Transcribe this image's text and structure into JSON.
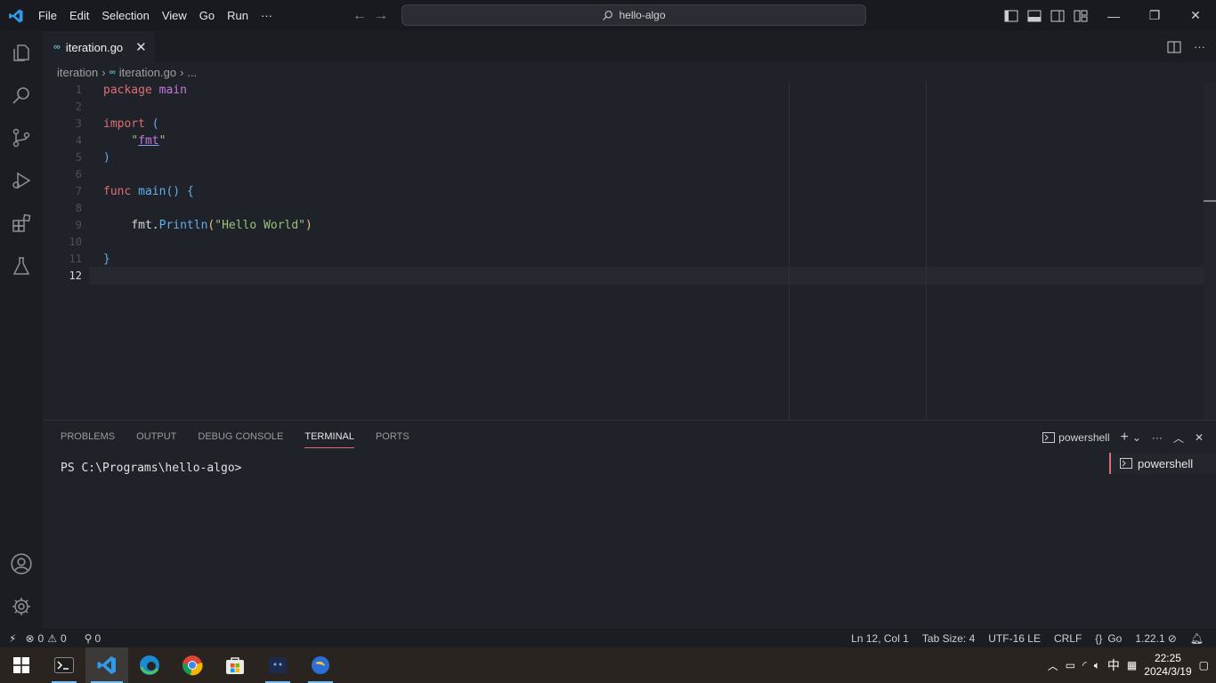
{
  "titlebar": {
    "menu": [
      "File",
      "Edit",
      "Selection",
      "View",
      "Go",
      "Run",
      "···"
    ],
    "command_center": "hello-algo",
    "window_controls": [
      "minimize",
      "restore",
      "close"
    ]
  },
  "activity_bar": [
    "explorer-icon",
    "search-icon",
    "source-control-icon",
    "run-debug-icon",
    "extensions-icon",
    "testing-icon",
    "accounts-icon",
    "manage-icon"
  ],
  "editor": {
    "tab_label": "iteration.go",
    "breadcrumb": [
      "iteration",
      "iteration.go",
      "..."
    ],
    "line_numbers": [
      "1",
      "2",
      "3",
      "4",
      "5",
      "6",
      "7",
      "8",
      "9",
      "10",
      "11",
      "12"
    ],
    "active_line": "12",
    "code": {
      "l1_kw": "package",
      "l1_id": "main",
      "l3_kw": "import",
      "l3_p": "(",
      "l4_q1": "\"",
      "l4_id": "fmt",
      "l4_q2": "\"",
      "l5_p": ")",
      "l7_kw": "func",
      "l7_fn": "main",
      "l7_p": "()",
      "l7_b": "{",
      "l9_pkg": "fmt",
      "l9_dot": ".",
      "l9_fn": "Println",
      "l9_p1": "(",
      "l9_str": "\"Hello World\"",
      "l9_p2": ")",
      "l11_b": "}"
    }
  },
  "panel": {
    "tabs": [
      "PROBLEMS",
      "OUTPUT",
      "DEBUG CONSOLE",
      "TERMINAL",
      "PORTS"
    ],
    "active_tab": "TERMINAL",
    "shell_label": "powershell",
    "terminal_prompt": "PS C:\\Programs\\hello-algo>",
    "terminal_list": [
      "powershell"
    ]
  },
  "statusbar": {
    "errors": "0",
    "warnings": "0",
    "ports": "0",
    "cursor": "Ln 12, Col 1",
    "tab_size": "Tab Size: 4",
    "encoding": "UTF-16 LE",
    "eol": "CRLF",
    "language": "Go",
    "go_version": "1.22.1"
  },
  "taskbar": {
    "apps": [
      "windows-start",
      "terminal",
      "vscode",
      "edge",
      "chrome",
      "store",
      "game",
      "app"
    ],
    "ime": "中",
    "time": "22:25",
    "date": "2024/3/19"
  },
  "colors": {
    "accent": "#e06c75",
    "bg": "#1f2228",
    "keyword": "#e06c75",
    "string": "#98c379",
    "function": "#61afef"
  }
}
